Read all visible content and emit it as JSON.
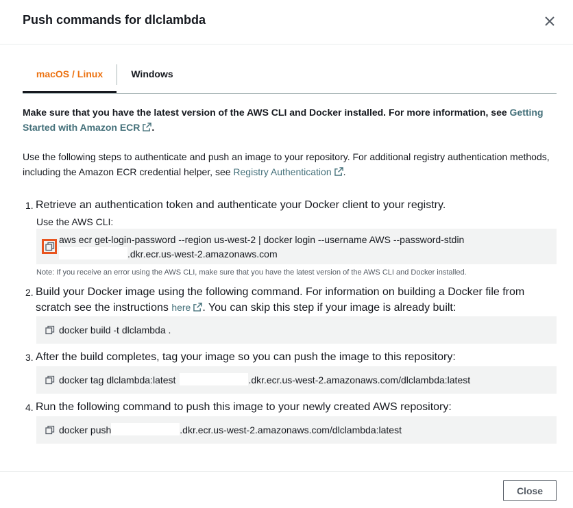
{
  "modal": {
    "title": "Push commands for dlclambda",
    "close_icon": "close-icon"
  },
  "tabs": [
    {
      "label": "macOS / Linux",
      "active": true
    },
    {
      "label": "Windows",
      "active": false
    }
  ],
  "intro": {
    "text1": "Make sure that you have the latest version of the AWS CLI and Docker installed. For more information, see ",
    "link1": "Getting Started with Amazon ECR",
    "text1_end": ".",
    "text2": "Use the following steps to authenticate and push an image to your repository. For additional registry authentication methods, including the Amazon ECR credential helper, see ",
    "link2": "Registry Authentication",
    "text2_end": "."
  },
  "steps": [
    {
      "num": "1.",
      "text": "Retrieve an authentication token and authenticate your Docker client to your registry.",
      "sublabel": "Use the AWS CLI:",
      "code_line1": "aws ecr get-login-password --region us-west-2 | docker login --username AWS --password-stdin",
      "code_line2": ".dkr.ecr.us-west-2.amazonaws.com",
      "note": "Note: If you receive an error using the AWS CLI, make sure that you have the latest version of the AWS CLI and Docker installed."
    },
    {
      "num": "2.",
      "text_a": "Build your Docker image using the following command. For information on building a Docker file from scratch see the instructions ",
      "link": "here",
      "text_b": ". You can skip this step if your image is already built:",
      "code": "docker build -t dlclambda ."
    },
    {
      "num": "3.",
      "text": "After the build completes, tag your image so you can push the image to this repository:",
      "code_a": "docker tag dlclambda:latest",
      "code_b": ".dkr.ecr.us-west-2.amazonaws.com/dlclambda:latest"
    },
    {
      "num": "4.",
      "text": "Run the following command to push this image to your newly created AWS repository:",
      "code_a": "docker push",
      "code_b": ".dkr.ecr.us-west-2.amazonaws.com/dlclambda:latest"
    }
  ],
  "footer": {
    "close_label": "Close"
  },
  "colors": {
    "accent_orange": "#ec7211",
    "link": "#44707a",
    "highlight": "#e8541f",
    "code_bg": "#f2f3f3"
  }
}
